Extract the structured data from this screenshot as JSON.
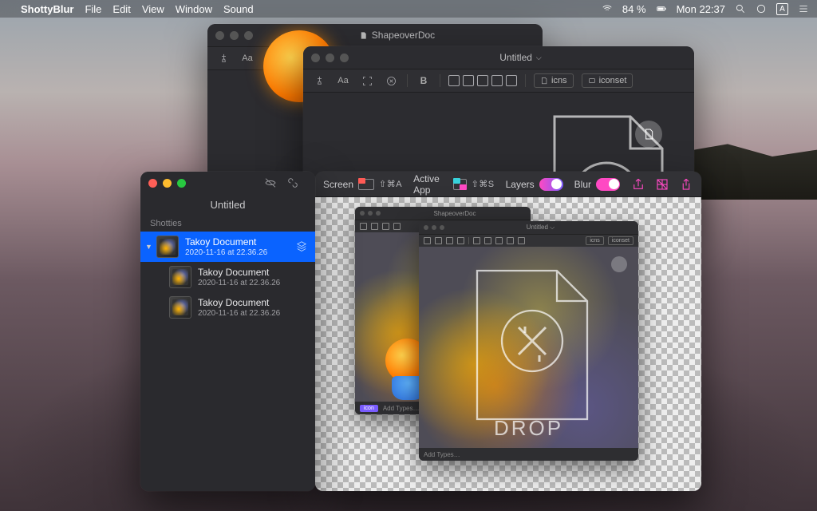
{
  "menubar": {
    "app": "ShottyBlur",
    "items": [
      "File",
      "Edit",
      "View",
      "Window",
      "Sound"
    ],
    "battery": "84 %",
    "clock": "Mon 22:37"
  },
  "window_back": {
    "title": "ShapeoverDoc"
  },
  "window_mid": {
    "title": "Untitled",
    "buttons": {
      "icns": "icns",
      "iconset": "iconset"
    }
  },
  "sidebar": {
    "title": "Untitled",
    "section": "Shotties",
    "items": [
      {
        "name": "Takoy Document",
        "ts": "2020-11-16 at 22.36.26"
      },
      {
        "name": "Takoy Document",
        "ts": "2020-11-16 at 22.36.26"
      },
      {
        "name": "Takoy Document",
        "ts": "2020-11-16 at 22.36.26"
      }
    ]
  },
  "capture": {
    "screen": "Screen",
    "screen_sc": "⇧⌘A",
    "active": "Active App",
    "active_sc": "⇧⌘S",
    "layers": "Layers",
    "blur": "Blur"
  },
  "preview": {
    "back_title": "ShapeoverDoc",
    "front_title": "Untitled",
    "icns": "icns",
    "iconset": "iconset",
    "drop": "DROP",
    "tag": "icon",
    "add": "Add Types…",
    "add2": "Add Types…"
  }
}
